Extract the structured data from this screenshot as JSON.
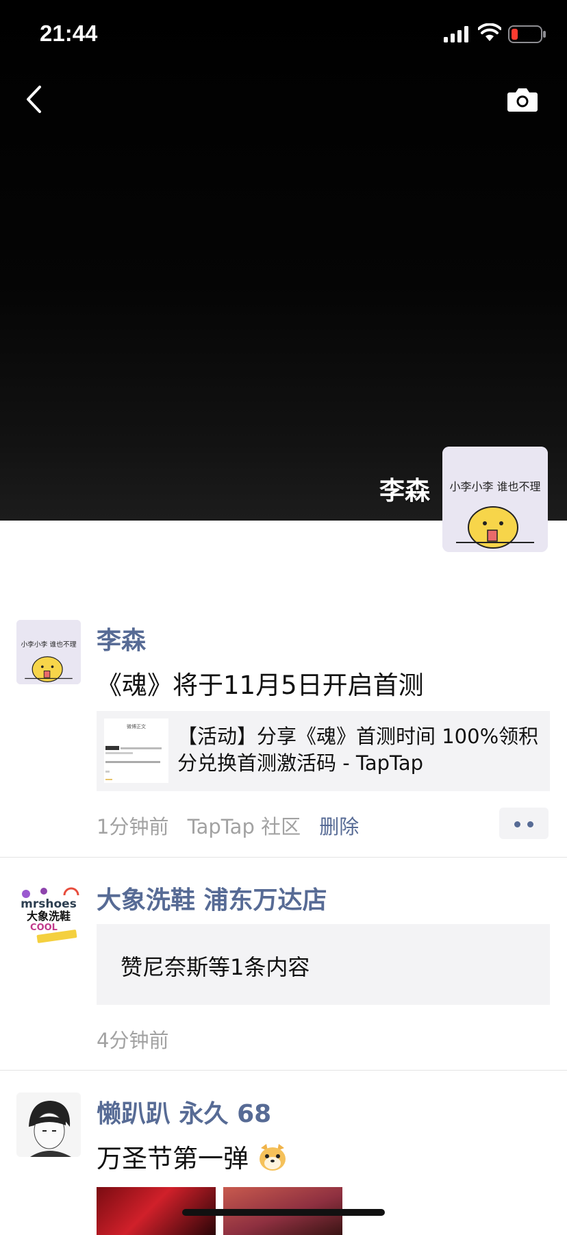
{
  "status_bar": {
    "time": "21:44"
  },
  "cover": {
    "name": "李森",
    "avatar_caption": "小李小李 谁也不理"
  },
  "posts": [
    {
      "name": "李森",
      "text": "《魂》将于11月5日开启首测",
      "link_title": "【活动】分享《魂》首测时间 100%领积分兑换首测激活码 - TapTap",
      "thumb_caption": "微博正文",
      "time": "1分钟前",
      "source": "TapTap 社区",
      "delete_label": "删除"
    },
    {
      "name": "大象洗鞋 浦东万达店",
      "avatar_caption": "mrshoes 大象洗鞋 COOL MADE IN CHINA",
      "aggregate": "赞尼奈斯等1条内容",
      "time": "4分钟前"
    },
    {
      "name": "懒趴趴 永久 68",
      "text": "万圣节第一弹"
    }
  ],
  "icons": [
    "signal-icon",
    "wifi-icon",
    "battery-icon",
    "back-icon",
    "camera-icon",
    "more-icon",
    "emoji-icon"
  ],
  "colors": {
    "link_blue": "#576b95",
    "battery_low": "#ff3b30",
    "card_bg": "#f3f3f5"
  }
}
